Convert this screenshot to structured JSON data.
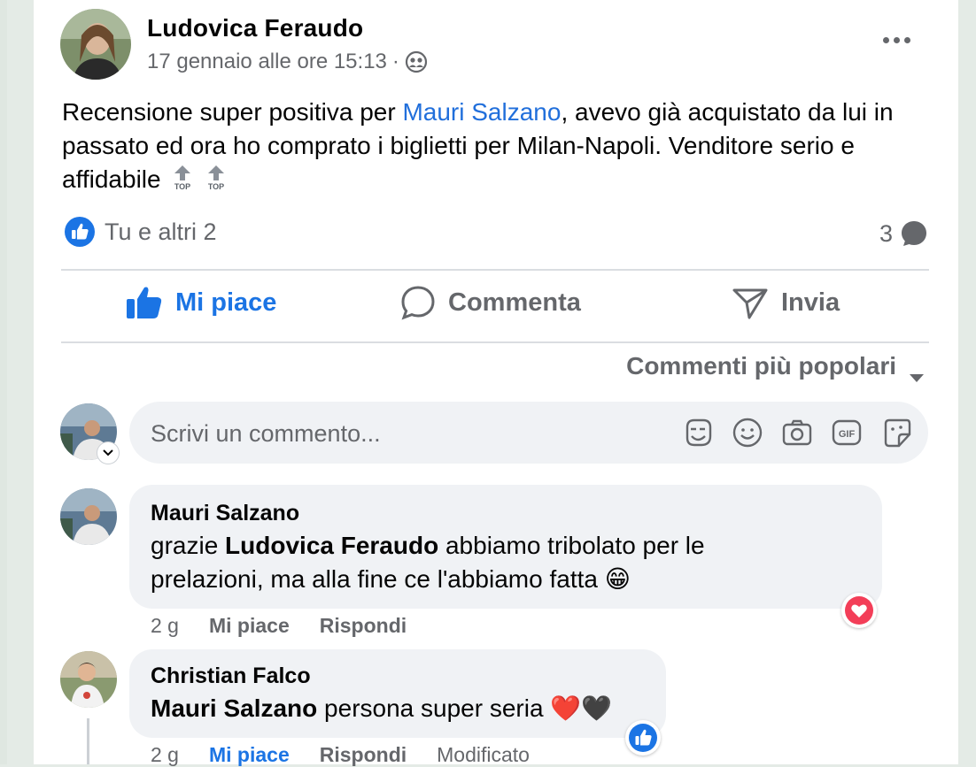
{
  "post": {
    "author": "Ludovica Feraudo",
    "timestamp": "17 gennaio alle ore 15:13",
    "meta_separator": "·",
    "audience_icon": "friends-icon",
    "text_before": "Recensione super positiva per ",
    "mention": "Mauri Salzano",
    "text_after": ", avevo già acquistato da lui in passato ed ora ho comprato i biglietti per Milan-Napoli. Venditore serio e affidabile",
    "emoji_label": "TOP",
    "reactions_text": "Tu e altri 2",
    "comments_count": "3"
  },
  "actions": {
    "like": "Mi piace",
    "comment": "Commenta",
    "send": "Invia"
  },
  "sort_label": "Commenti più popolari",
  "composer": {
    "placeholder": "Scrivi un commento...",
    "icons": [
      "avatar-sticker-icon",
      "emoji-icon",
      "camera-icon",
      "gif-icon",
      "sticker-icon"
    ],
    "gif_label": "GIF"
  },
  "comments": [
    {
      "author": "Mauri Salzano",
      "text_prefix": "grazie ",
      "tagged": "Ludovica Feraudo",
      "text_suffix": " abbiamo tribolato per le prelazioni, ma alla fine ce l'abbiamo fatta",
      "emoji": "😁",
      "time": "2 g",
      "like": "Mi piace",
      "reply": "Rispondi",
      "reaction": "love"
    },
    {
      "author": "Christian Falco",
      "tagged": "Mauri Salzano",
      "text_suffix": " persona super seria",
      "emoji": "❤️🖤",
      "time": "2 g",
      "like": "Mi piace",
      "reply": "Rispondi",
      "edited": "Modificato",
      "reaction": "like"
    }
  ],
  "colors": {
    "accent_blue": "#1b74e4",
    "mention_blue": "#216fdb",
    "secondary_text": "#65676b",
    "bubble_bg": "#f0f2f5",
    "love_red": "#f33e58"
  }
}
